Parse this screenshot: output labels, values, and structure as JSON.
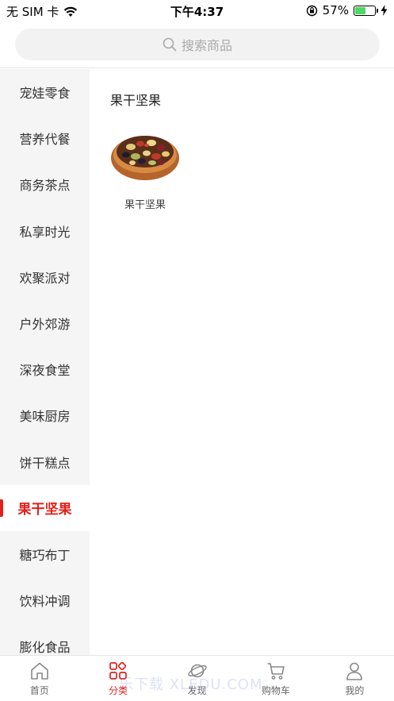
{
  "status": {
    "carrier": "无 SIM 卡",
    "time": "下午4:37",
    "battery_percent_label": "57%",
    "battery_level": 0.57
  },
  "search": {
    "placeholder": "搜索商品"
  },
  "sidebar": {
    "items": [
      {
        "label": "宠娃零食"
      },
      {
        "label": "营养代餐"
      },
      {
        "label": "商务茶点"
      },
      {
        "label": "私享时光"
      },
      {
        "label": "欢聚派对"
      },
      {
        "label": "户外郊游"
      },
      {
        "label": "深夜食堂"
      },
      {
        "label": "美味厨房"
      },
      {
        "label": "饼干糕点"
      },
      {
        "label": "果干坚果"
      },
      {
        "label": "糖巧布丁"
      },
      {
        "label": "饮料冲调"
      },
      {
        "label": "膨化食品"
      }
    ],
    "active_index": 9
  },
  "main": {
    "section_title": "果干坚果",
    "products": [
      {
        "label": "果干坚果"
      }
    ]
  },
  "tabs": [
    {
      "label": "首页",
      "icon": "home-icon"
    },
    {
      "label": "分类",
      "icon": "category-icon",
      "active": true
    },
    {
      "label": "发现",
      "icon": "planet-icon"
    },
    {
      "label": "购物车",
      "icon": "cart-icon"
    },
    {
      "label": "我的",
      "icon": "user-icon"
    }
  ],
  "watermark": "乐下载 XLEDU.COM",
  "colors": {
    "accent": "#e4201b",
    "sidebar_bg": "#f5f5f5",
    "battery": "#4cd964"
  }
}
